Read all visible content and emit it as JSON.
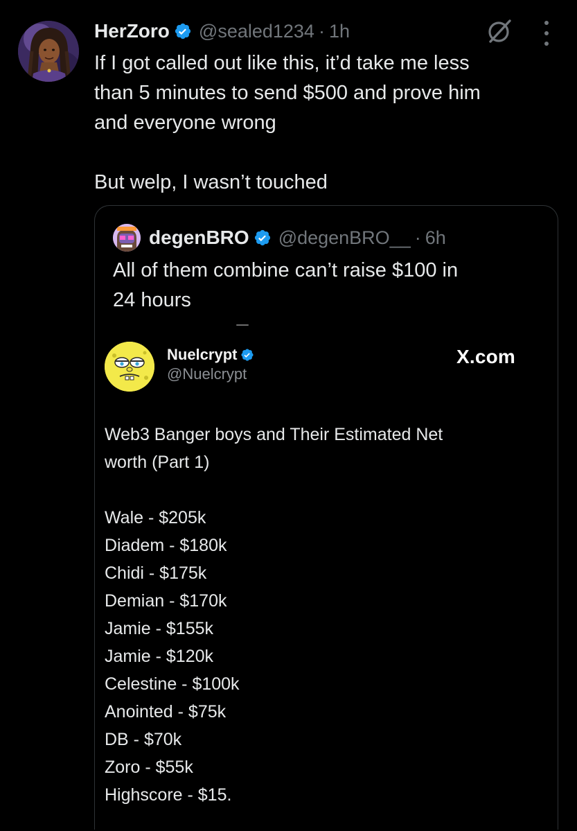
{
  "tweet": {
    "display_name": "HerZoro",
    "handle": "@sealed1234",
    "separator": "·",
    "time": "1h",
    "text_lines": [
      "If I got called out like this, it’d take me less",
      "than 5 minutes to send $500 and prove him",
      "and everyone wrong"
    ],
    "text_last": "But welp, I wasn’t touched"
  },
  "quote": {
    "display_name": "degenBRO",
    "handle": "@degenBRO__",
    "separator": "·",
    "time": "6h",
    "text_lines": [
      "All of them combine can’t raise $100 in",
      "24 hours"
    ]
  },
  "embed": {
    "display_name": "Nuelcrypt",
    "handle": "@Nuelcrypt",
    "source": "X.com",
    "intro_lines": [
      "Web3 Banger boys and Their Estimated Net",
      "worth (Part 1)"
    ],
    "list": [
      "Wale - $205k",
      "Diadem - $180k",
      "Chidi - $175k",
      "Demian - $170k",
      "Jamie - $155k",
      "Jamie - $120k",
      "Celestine - $100k",
      "Anointed - $75k",
      "DB - $70k",
      "Zoro - $55k",
      "Highscore - $15."
    ]
  },
  "colors": {
    "background": "#000000",
    "text": "#e7e9ea",
    "muted": "#71767b",
    "verified": "#1d9bf0",
    "border": "#2f3336"
  },
  "icons": {
    "verified": "verified-badge-icon",
    "grok": "grok-icon",
    "more": "more-options-icon"
  }
}
